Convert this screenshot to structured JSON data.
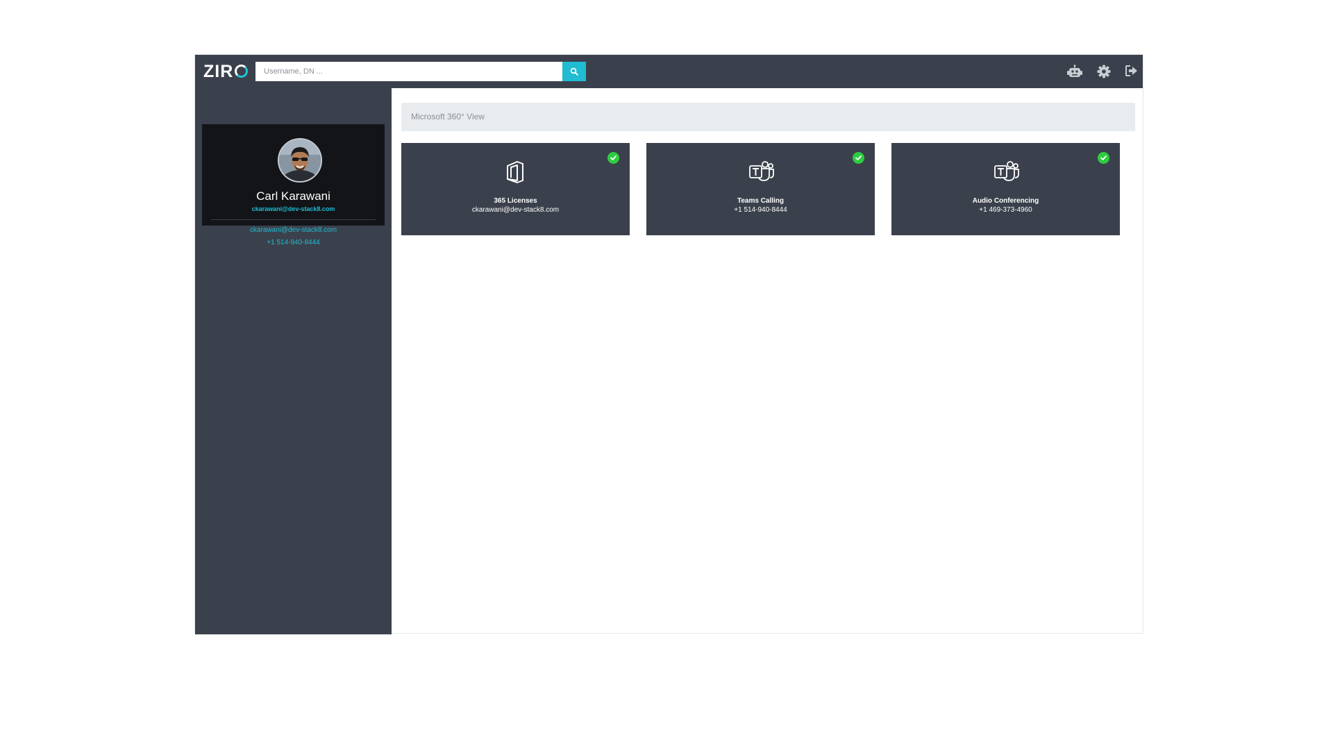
{
  "header": {
    "logo_text": "ZIR",
    "search": {
      "placeholder": "Username, DN ...",
      "value": ""
    },
    "icons": [
      "robot-icon",
      "gear-icon",
      "sign-out-icon"
    ]
  },
  "profile": {
    "name": "Carl Karawani",
    "email_primary": "ckarawani@dev-stack8.com",
    "email": "ckarawani@dev-stack8.com",
    "phone": "+1 514-940-8444"
  },
  "main": {
    "section_title": "Microsoft 360° View",
    "cards": [
      {
        "title": "365 Licenses",
        "subtitle": "ckarawani@dev-stack8.com",
        "icon": "office-icon",
        "status": "ok"
      },
      {
        "title": "Teams Calling",
        "subtitle": "+1 514-940-8444",
        "icon": "teams-icon",
        "status": "ok"
      },
      {
        "title": "Audio Conferencing",
        "subtitle": "+1 469-373-4960",
        "icon": "teams-icon",
        "status": "ok"
      }
    ]
  },
  "colors": {
    "dark": "#3b414c",
    "card_dark": "#121418",
    "accent": "#1fbcd2",
    "success": "#2ecc40",
    "header_bg": "#e9ecef"
  }
}
